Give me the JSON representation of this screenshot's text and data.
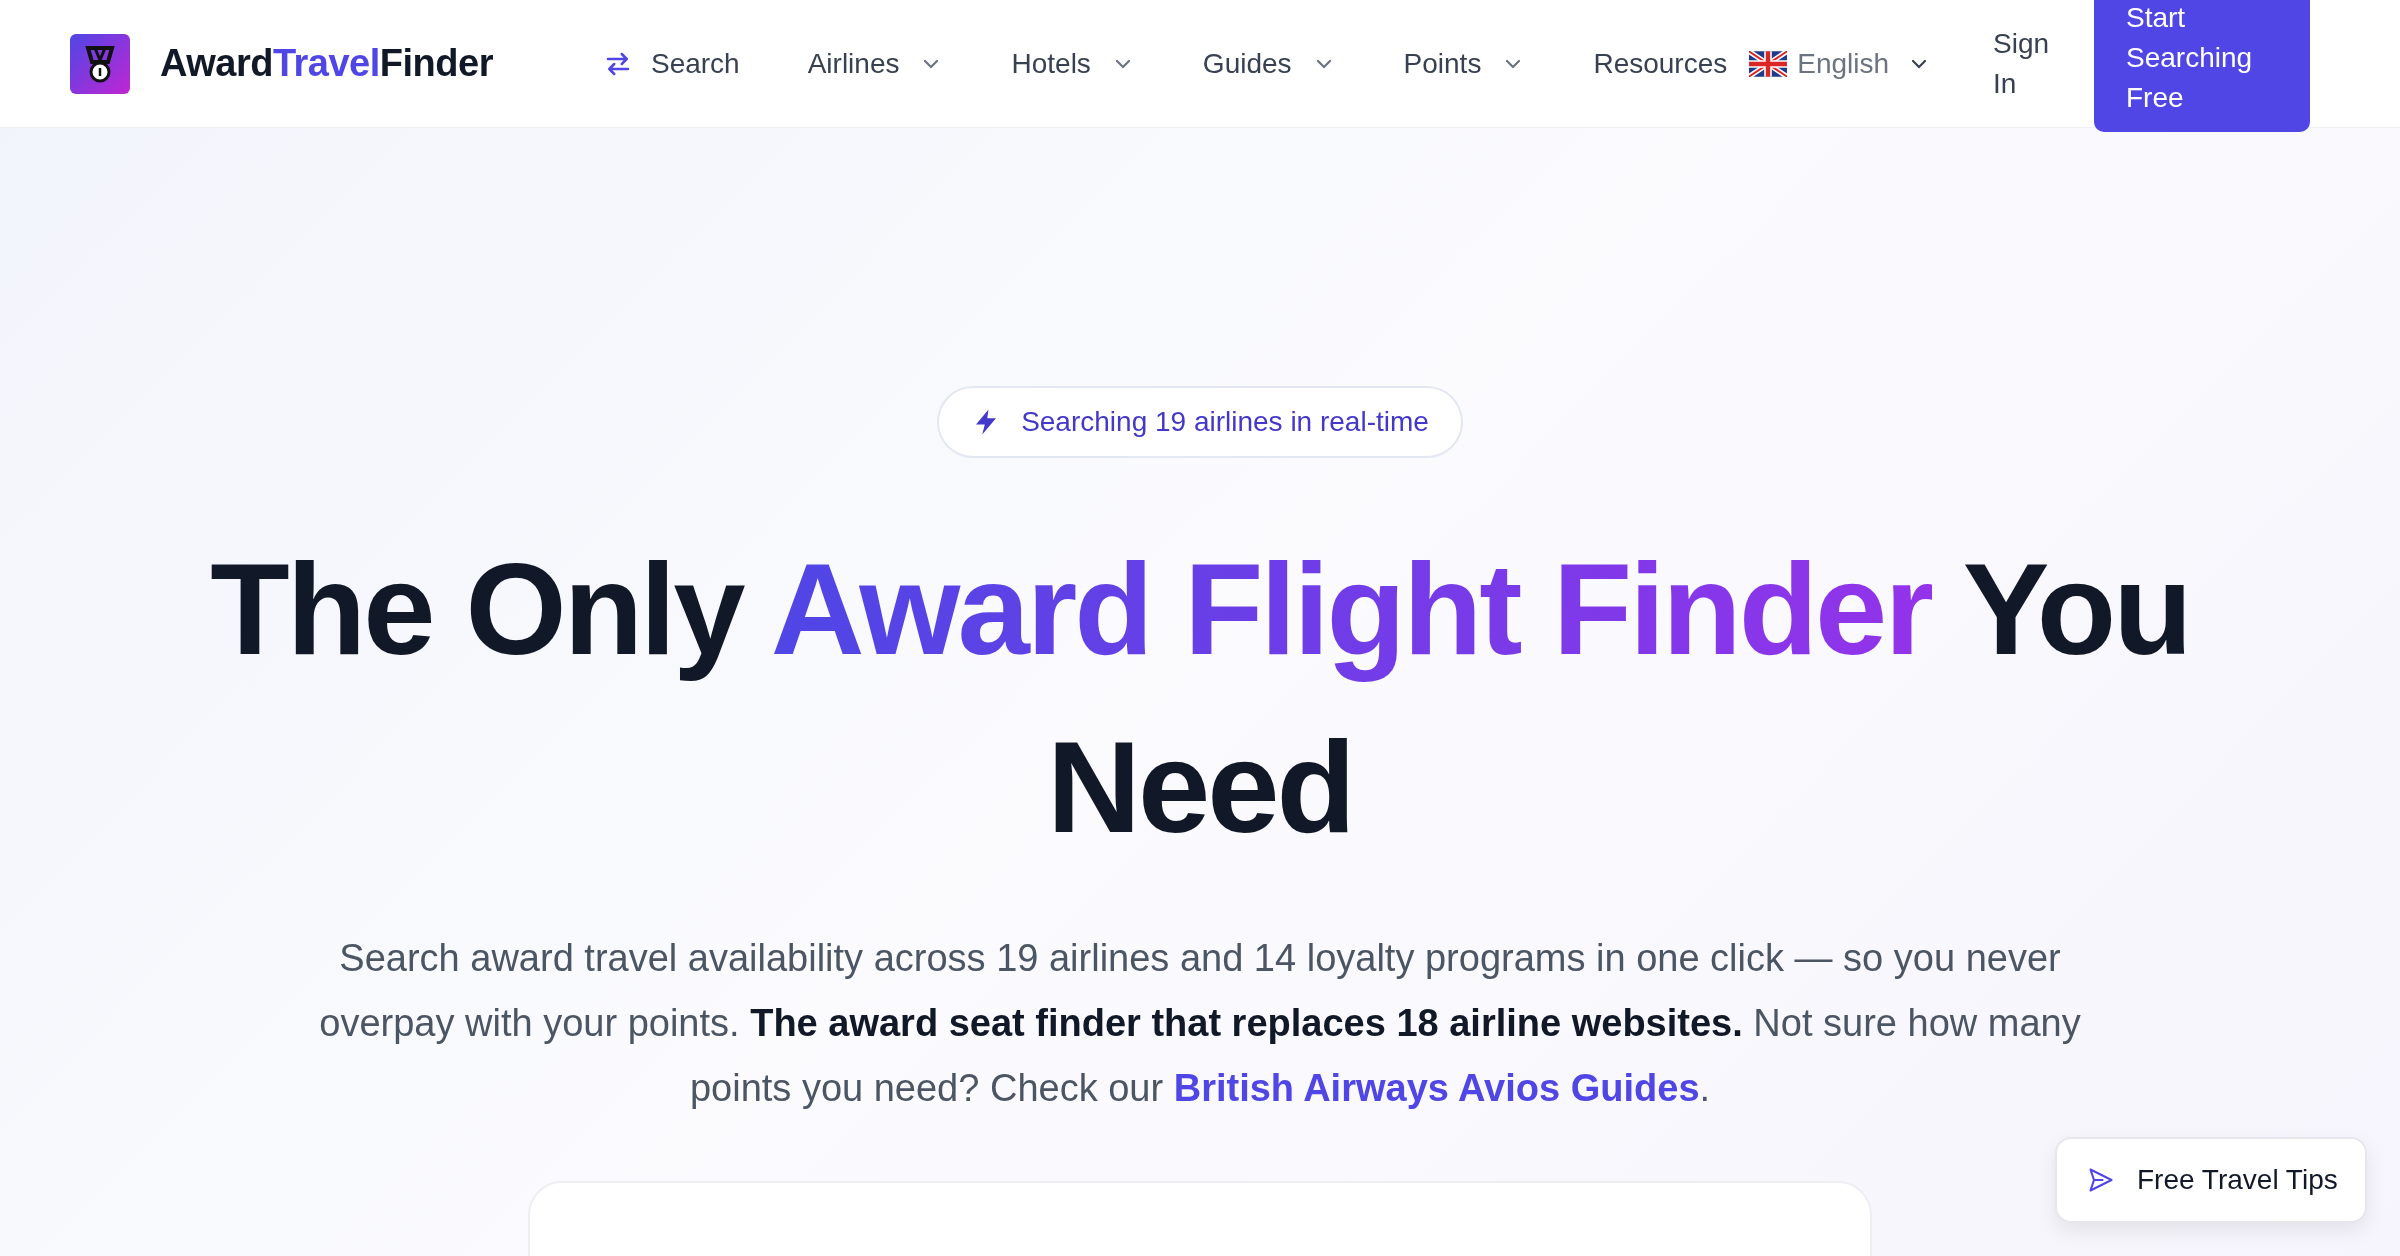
{
  "brand": {
    "parts": [
      {
        "text": "Award",
        "accent": false
      },
      {
        "text": "Travel",
        "accent": true
      },
      {
        "text": "Finder",
        "accent": false
      }
    ]
  },
  "nav": [
    {
      "label": "Search",
      "kind": "search"
    },
    {
      "label": "Airlines",
      "kind": "dropdown"
    },
    {
      "label": "Hotels",
      "kind": "dropdown"
    },
    {
      "label": "Guides",
      "kind": "dropdown"
    },
    {
      "label": "Points",
      "kind": "dropdown"
    },
    {
      "label": "Resources",
      "kind": "link"
    }
  ],
  "language": {
    "label": "English"
  },
  "sign_in": "Sign In",
  "cta": "Start Searching Free",
  "badge": "Searching 19 airlines in real-time",
  "headline": {
    "before": "The Only ",
    "highlight": "Award Flight Finder",
    "after": " You Need"
  },
  "description": {
    "text": "Search award travel availability across 19 airlines and 14 loyalty programs in one click — so you never overpay with your points. **The award seat finder that replaces 18 airline websites.** Not sure how many points you need? Check our ",
    "link": "British Airways Avios Guides",
    "end": "."
  },
  "tips_button": "Free Travel Tips"
}
